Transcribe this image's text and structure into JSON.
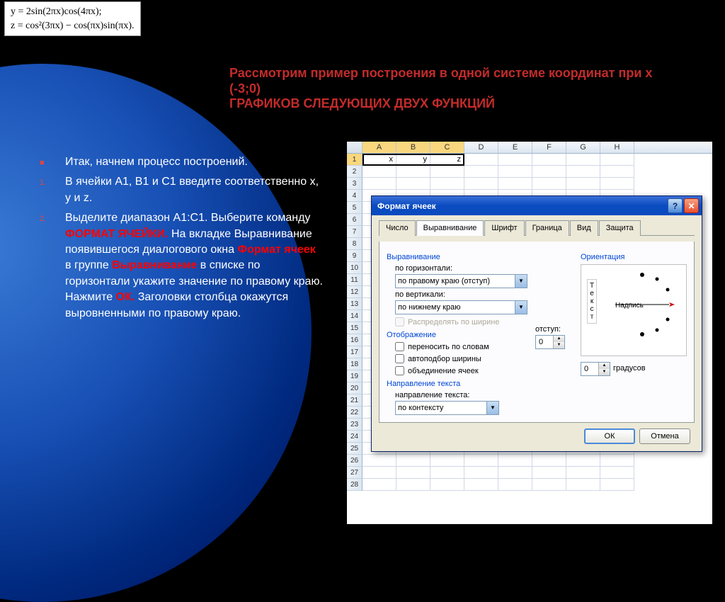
{
  "formula": {
    "line1": "y = 2sin(2πx)cos(4πx);",
    "line2": "z = cos²(3πx) − cos(πx)sin(πx)."
  },
  "title": {
    "line1": "Рассмотрим пример построения в одной системе координат при x (-3;0)",
    "line2": "ГРАФИКОВ СЛЕДУЮЩИХ ДВУХ ФУНКЦИЙ"
  },
  "content": {
    "intro": "Итак, начнем процесс построений.",
    "step1": "В ячейки А1, В1 и С1 введите соответственно  x, y и z.",
    "step2_a": "Выделите диапазон А1:С1. Выберите команду  ",
    "step2_format": "ФОРМАТ ЯЧЕЙКИ.",
    "step2_b": " На вкладке Выравнивание появившегося диалогового окна ",
    "step2_fc": "Формат ячеек",
    "step2_c": " в группе ",
    "step2_align": "Выравнивание",
    "step2_d": " в списке по горизонтали укажите значение по правому краю. Нажмите ",
    "step2_ok": "ОК.",
    "step2_e": " Заголовки столбца окажутся выровненными по правому краю."
  },
  "excel": {
    "cols": [
      "A",
      "B",
      "C",
      "D",
      "E",
      "F",
      "G",
      "H"
    ],
    "row1": {
      "A": "x",
      "B": "y",
      "C": "z"
    },
    "rowcount": 28
  },
  "dialog": {
    "title": "Формат ячеек",
    "tabs": [
      "Число",
      "Выравнивание",
      "Шрифт",
      "Граница",
      "Вид",
      "Защита"
    ],
    "active_tab": 1,
    "groups": {
      "align": "Выравнивание",
      "horiz": "по горизонтали:",
      "horiz_val": "по правому краю (отступ)",
      "indent": "отступ:",
      "indent_val": "0",
      "vert": "по вертикали:",
      "vert_val": "по нижнему краю",
      "distribute": "Распределять по ширине",
      "display": "Отображение",
      "wrap": "переносить по словам",
      "autofit": "автоподбор ширины",
      "merge": "объединение ячеек",
      "textdir": "Направление текста",
      "textdir_label": "направление текста:",
      "textdir_val": "по контексту",
      "orient": "Ориентация",
      "orient_text": "Текст",
      "orient_label": "Надпись",
      "degrees_val": "0",
      "degrees": "градусов"
    },
    "ok": "ОК",
    "cancel": "Отмена"
  }
}
